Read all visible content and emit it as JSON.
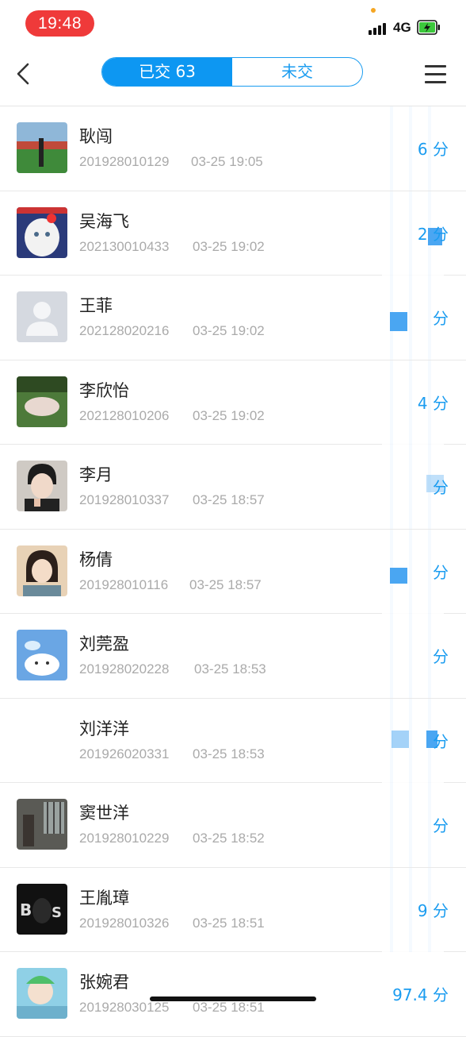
{
  "status_bar": {
    "time": "19:48",
    "network": "4G",
    "battery_color": "#3cc83c"
  },
  "nav": {
    "back_icon": "chevron-left-icon",
    "tabs": [
      {
        "label": "已交 63",
        "active": true
      },
      {
        "label": "未交",
        "active": false
      }
    ],
    "menu_icon": "hamburger-menu-icon"
  },
  "students": [
    {
      "name": "耿闯",
      "id": "201928010129",
      "time": "03-25 19:05",
      "score": "6 分",
      "avatar": "field-photo"
    },
    {
      "name": "吴海飞",
      "id": "202130010433",
      "time": "03-25 19:02",
      "score": "2 分",
      "avatar": "cat-photo"
    },
    {
      "name": "王菲",
      "id": "202128020216",
      "time": "03-25 19:02",
      "score": "分",
      "avatar": "default-person"
    },
    {
      "name": "李欣怡",
      "id": "202128010206",
      "time": "03-25 19:02",
      "score": "4 分",
      "avatar": "grass-photo"
    },
    {
      "name": "李月",
      "id": "201928010337",
      "time": "03-25 18:57",
      "score": "分",
      "avatar": "girl-photo"
    },
    {
      "name": "杨倩",
      "id": "201928010116",
      "time": "03-25 18:57",
      "score": "分",
      "avatar": "portrait-photo"
    },
    {
      "name": "刘莞盈",
      "id": "201928020228",
      "time": "03-25 18:53",
      "score": "分",
      "avatar": "cartoon-sky"
    },
    {
      "name": "刘洋洋",
      "id": "201926020331",
      "time": "03-25 18:53",
      "score": "分",
      "avatar": "none"
    },
    {
      "name": "窦世洋",
      "id": "201928010229",
      "time": "03-25 18:52",
      "score": "分",
      "avatar": "window-photo"
    },
    {
      "name": "王胤璋",
      "id": "201928010326",
      "time": "03-25 18:51",
      "score": "9 分",
      "avatar": "dark-photo"
    },
    {
      "name": "张婉君",
      "id": "201928030125",
      "time": "03-25 18:51",
      "score": "97.4 分",
      "avatar": "anime-photo"
    }
  ]
}
